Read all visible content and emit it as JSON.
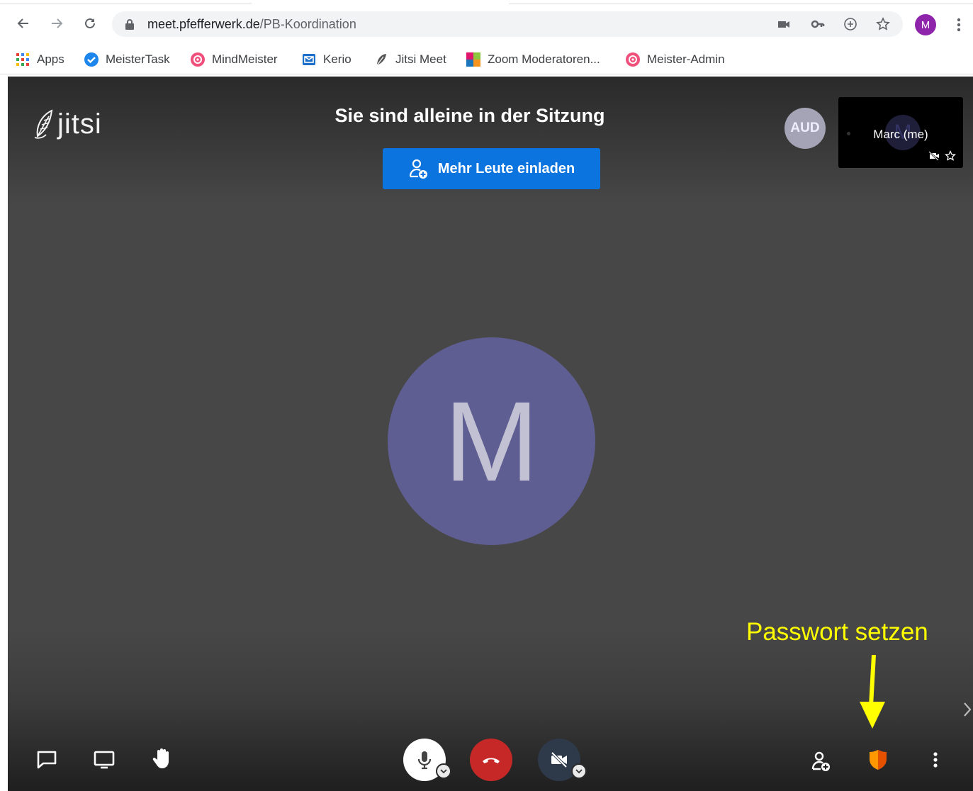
{
  "browser": {
    "url_domain": "meet.pfefferwerk.de",
    "url_path": "/PB-Koordination",
    "profile_initial": "M",
    "accent_profile_color": "#8e24aa"
  },
  "bookmarks": [
    {
      "label": "Apps",
      "icon": "apps-grid-icon"
    },
    {
      "label": "MeisterTask",
      "icon": "meistertask-icon"
    },
    {
      "label": "MindMeister",
      "icon": "mindmeister-icon"
    },
    {
      "label": "Kerio",
      "icon": "kerio-mail-icon"
    },
    {
      "label": "Jitsi Meet",
      "icon": "jitsi-leaf-icon"
    },
    {
      "label": "Zoom Moderatoren...",
      "icon": "zoom-tile-icon"
    },
    {
      "label": "Meister-Admin",
      "icon": "meister-admin-icon"
    }
  ],
  "jitsi": {
    "logo_text": "jitsi",
    "alone_title": "Sie sind alleine in der Sitzung",
    "invite_button": "Mehr Leute einladen",
    "audio_badge": "AUD",
    "self_name": "Marc (me)",
    "avatar_initial": "M",
    "avatar_color": "#5f5e92",
    "invite_color": "#0b74de",
    "hangup_color": "#c62828"
  },
  "annotation": {
    "text": "Passwort setzen",
    "color": "#ffff00"
  }
}
